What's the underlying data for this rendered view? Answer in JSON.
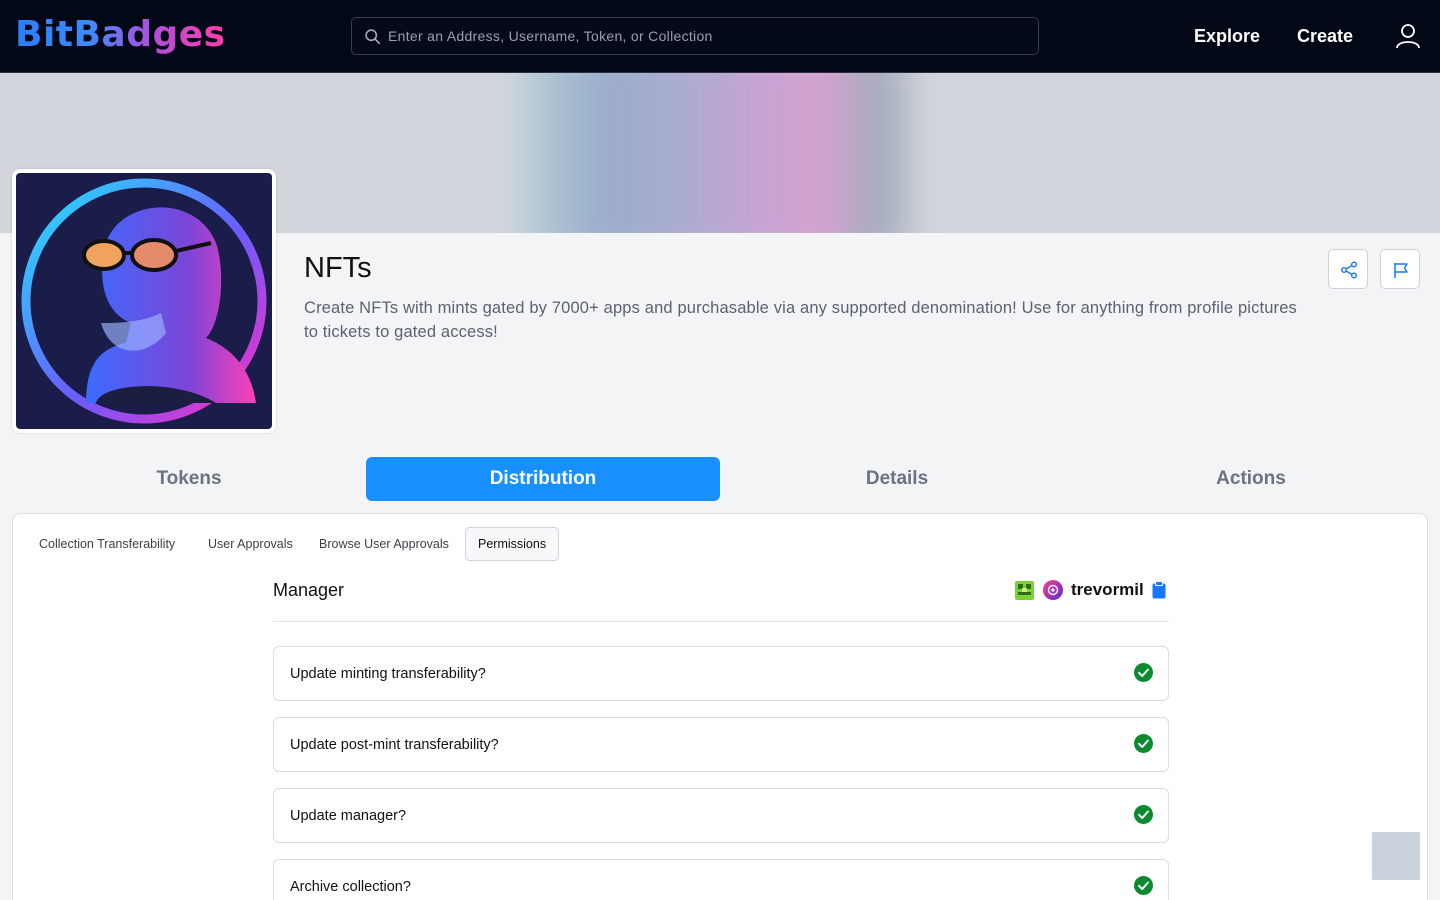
{
  "app": {
    "logo_text": "BitBadges",
    "brand_gradient": [
      "#2b7cff",
      "#b14dd9",
      "#ff3da8"
    ]
  },
  "topbar": {
    "search_placeholder": "Enter an Address, Username, Token, or Collection",
    "search_value": "",
    "nav": {
      "explore_label": "Explore",
      "create_label": "Create"
    },
    "icons": [
      "search-icon",
      "user-icon"
    ]
  },
  "collection": {
    "title": "NFTs",
    "description": "Create NFTs with mints gated by 7000+ apps and purchasable via any supported denomination! Use for anything from profile pictures to tickets to gated access!",
    "action_icons": [
      "share-icon",
      "flag-icon"
    ]
  },
  "main_tabs": [
    {
      "label": "Tokens",
      "active": false
    },
    {
      "label": "Distribution",
      "active": true
    },
    {
      "label": "Details",
      "active": false
    },
    {
      "label": "Actions",
      "active": false
    }
  ],
  "sub_tabs": [
    {
      "label": "Collection Transferability",
      "active": false
    },
    {
      "label": "User Approvals",
      "active": false
    },
    {
      "label": "Browse User Approvals",
      "active": false
    },
    {
      "label": "Permissions",
      "active": true
    }
  ],
  "manager": {
    "label": "Manager",
    "username": "trevormil",
    "icons": [
      "chain-badge-icon",
      "profile-avatar-icon",
      "copy-icon"
    ]
  },
  "permissions": [
    {
      "label": "Update minting transferability?",
      "status": "check-icon"
    },
    {
      "label": "Update post-mint transferability?",
      "status": "check-icon"
    },
    {
      "label": "Update manager?",
      "status": "check-icon"
    },
    {
      "label": "Archive collection?",
      "status": "check-icon"
    }
  ],
  "colors": {
    "accent": "#1890ff",
    "check_green": "#0b8a2e",
    "topbar_bg": "#030816"
  }
}
